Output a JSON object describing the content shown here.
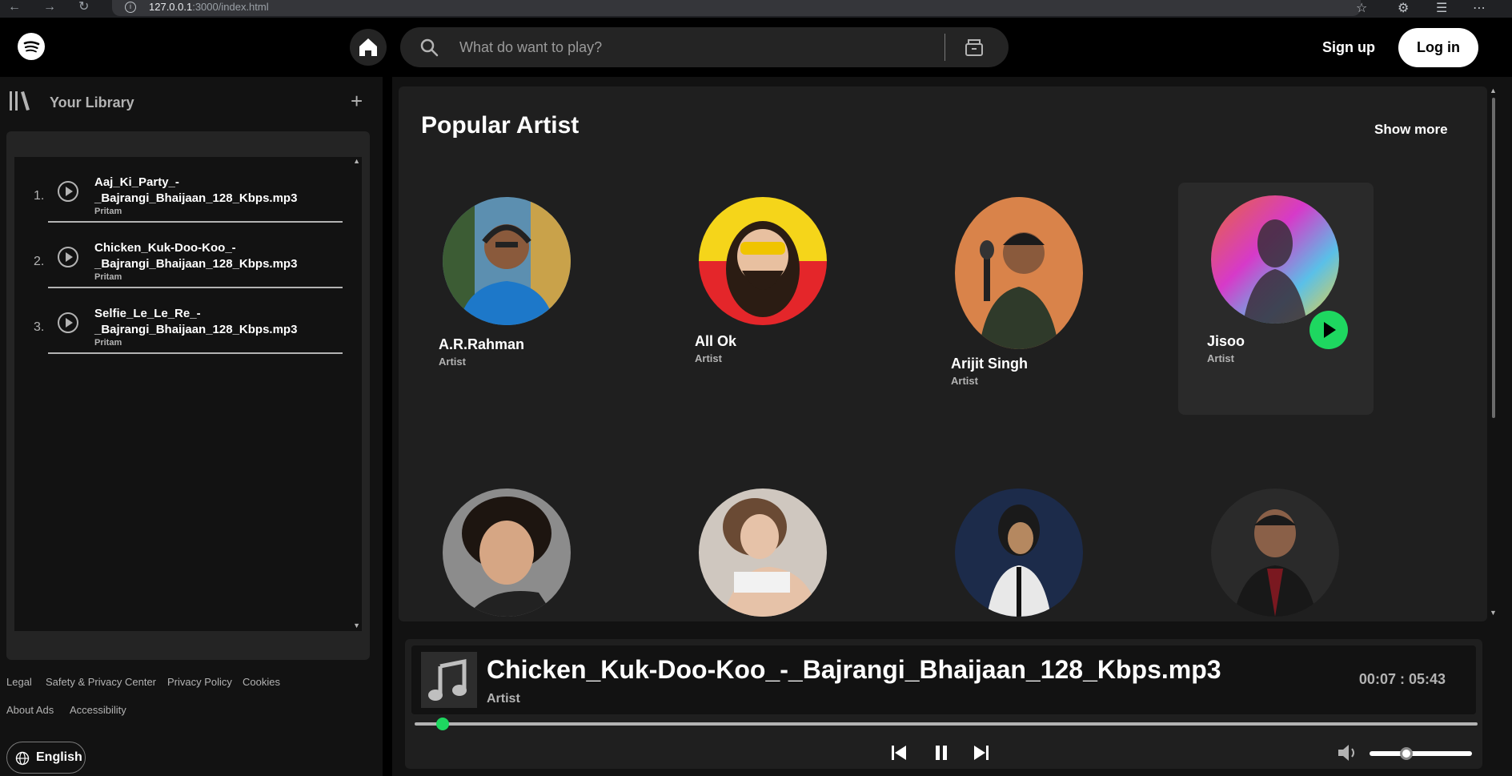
{
  "browser": {
    "url_host": "127.0.0.1",
    "url_rest": ":3000/index.html"
  },
  "header": {
    "search_placeholder": "What do want to play?",
    "signup_label": "Sign up",
    "login_label": "Log in"
  },
  "sidebar": {
    "library_title": "Your Library",
    "songs": [
      {
        "num": "1.",
        "title": "Aaj_Ki_Party_-_Bajrangi_Bhaijaan_128_Kbps.mp3",
        "artist": "Pritam"
      },
      {
        "num": "2.",
        "title": "Chicken_Kuk-Doo-Koo_-_Bajrangi_Bhaijaan_128_Kbps.mp3",
        "artist": "Pritam"
      },
      {
        "num": "3.",
        "title": "Selfie_Le_Le_Re_-_Bajrangi_Bhaijaan_128_Kbps.mp3",
        "artist": "Pritam"
      }
    ],
    "footer_links": [
      "Legal",
      "Safety & Privacy Center",
      "Privacy Policy",
      "Cookies",
      "About Ads",
      "Accessibility"
    ],
    "language": "English"
  },
  "main": {
    "section_title": "Popular Artist",
    "show_more": "Show more",
    "artists": [
      {
        "name": "A.R.Rahman",
        "role": "Artist"
      },
      {
        "name": "All Ok",
        "role": "Artist"
      },
      {
        "name": "Arijit Singh",
        "role": "Artist"
      },
      {
        "name": "Jisoo",
        "role": "Artist"
      }
    ]
  },
  "player": {
    "title": "Chicken_Kuk-Doo-Koo_-_Bajrangi_Bhaijaan_128_Kbps.mp3",
    "artist": "Artist",
    "time": "00:07 : 05:43",
    "progress_fraction": 0.02,
    "volume_fraction": 0.3
  },
  "colors": {
    "accent": "#1ed760",
    "background": "#000000",
    "panel": "#121212",
    "card": "#1f1f1f"
  }
}
